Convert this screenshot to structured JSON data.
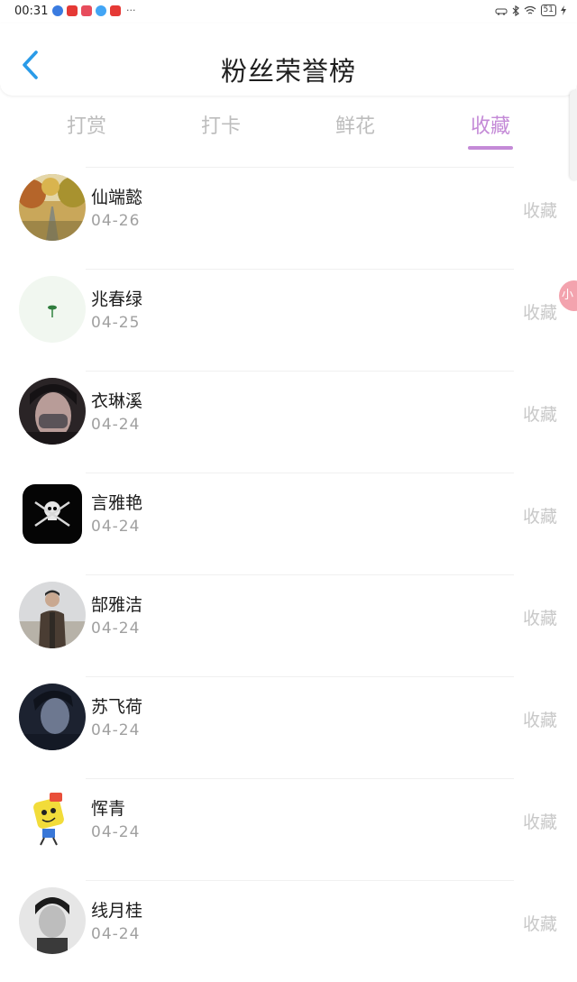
{
  "status_bar": {
    "time": "00:31",
    "battery": "51",
    "more": "···"
  },
  "header": {
    "title": "粉丝荣誉榜"
  },
  "tabs": [
    {
      "label": "打赏"
    },
    {
      "label": "打卡"
    },
    {
      "label": "鲜花"
    },
    {
      "label": "收藏",
      "active": true
    }
  ],
  "float_bubble": {
    "label": "小"
  },
  "fans": [
    {
      "name": "仙端懿",
      "date": "04-26",
      "action": "收藏",
      "avatar": "autumn-road"
    },
    {
      "name": "兆春绿",
      "date": "04-25",
      "action": "收藏",
      "avatar": "sprout"
    },
    {
      "name": "衣琳溪",
      "date": "04-24",
      "action": "收藏",
      "avatar": "masked-face"
    },
    {
      "name": "言雅艳",
      "date": "04-24",
      "action": "收藏",
      "avatar": "skull"
    },
    {
      "name": "郜雅洁",
      "date": "04-24",
      "action": "收藏",
      "avatar": "man-outdoors"
    },
    {
      "name": "苏飞荷",
      "date": "04-24",
      "action": "收藏",
      "avatar": "dark-portrait"
    },
    {
      "name": "恽青",
      "date": "04-24",
      "action": "收藏",
      "avatar": "cartoon"
    },
    {
      "name": "线月桂",
      "date": "04-24",
      "action": "收藏",
      "avatar": "bw-portrait"
    }
  ],
  "colors": {
    "accent": "#c48ad7",
    "back": "#2a9be8",
    "muted": "#c8c8c8"
  }
}
